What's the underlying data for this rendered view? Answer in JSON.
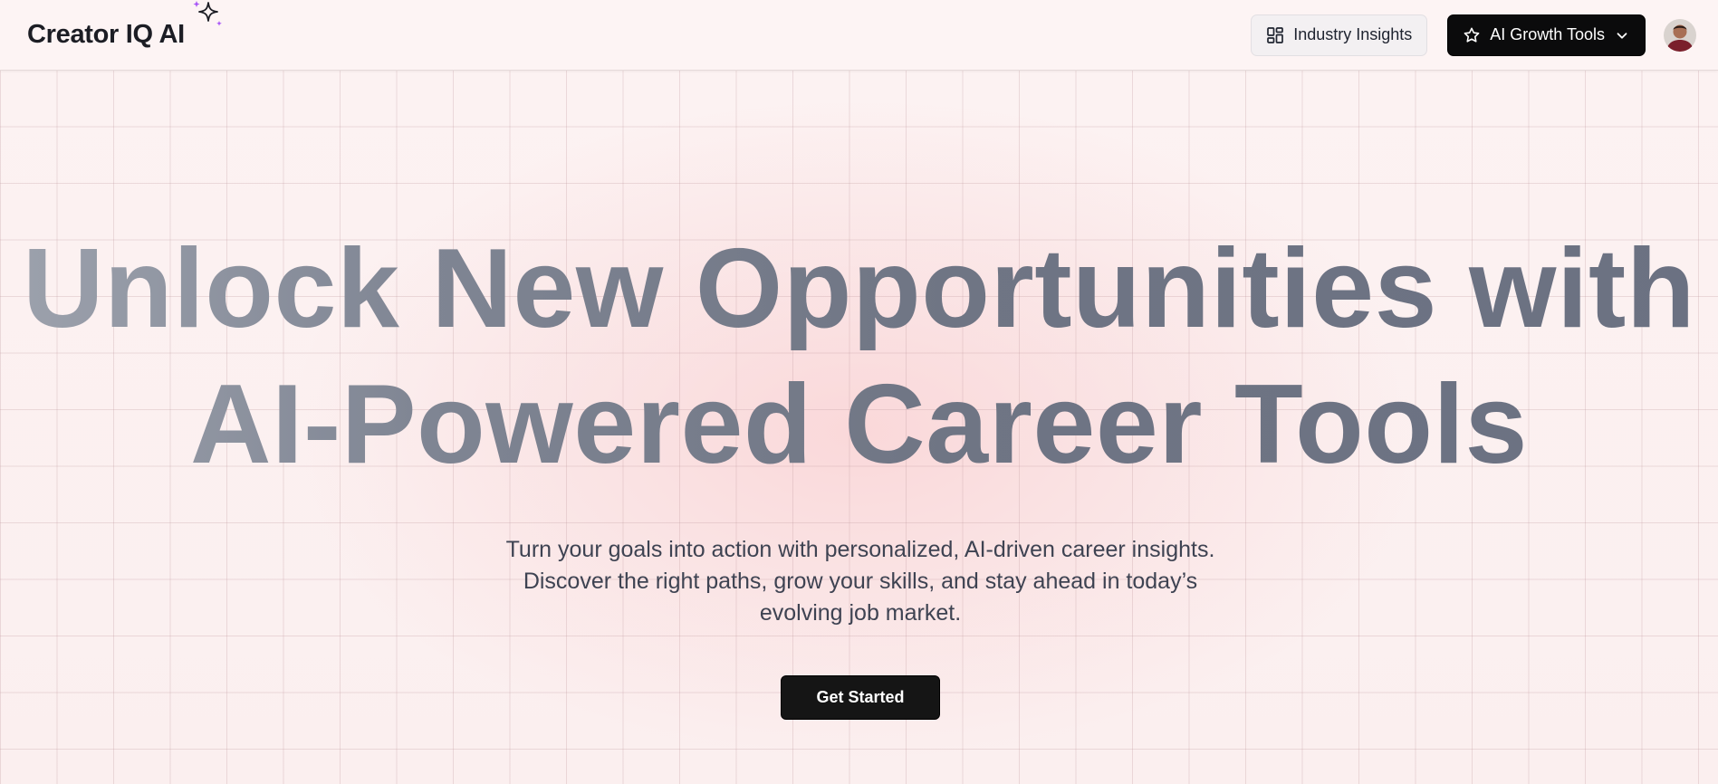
{
  "header": {
    "brand": "Creator IQ AI",
    "industry_insights_label": "Industry Insights",
    "growth_tools_label": "AI Growth Tools"
  },
  "hero": {
    "headline_line1": "Unlock New Opportunities with",
    "headline_line2": "AI-Powered Career Tools",
    "subtext": "Turn your goals into action with personalized, AI-driven career insights. Discover the right paths, grow your skills, and stay ahead in today’s evolving job market.",
    "cta_label": "Get Started"
  },
  "icons": {
    "brand_sparkle": "sparkle-icon",
    "industry_insights": "dashboard-grid-icon",
    "growth_tools": "star-icon",
    "dropdown": "chevron-down-icon"
  },
  "colors": {
    "accent_sparkle": "#a855f7",
    "primary_button": "#0b0b0c",
    "headline": "#6f7584",
    "background": "#fdf1f1"
  }
}
